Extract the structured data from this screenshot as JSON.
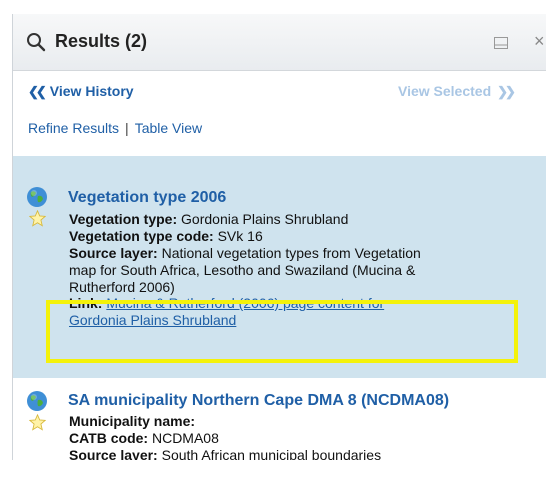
{
  "header": {
    "title": "Results (2)"
  },
  "nav": {
    "view_history": "View History",
    "view_selected": "View Selected"
  },
  "links": {
    "refine": "Refine Results",
    "separator": "|",
    "table_view": "Table View"
  },
  "results": [
    {
      "title": "Vegetation type 2006",
      "fields": [
        {
          "label": "Vegetation type:",
          "value": "Gordonia Plains Shrubland"
        },
        {
          "label": "Vegetation type code:",
          "value": "SVk 16"
        }
      ],
      "source_label": "Source layer:",
      "source_lines": [
        "National vegetation types from Vegetation",
        "map for South Africa, Lesotho and Swaziland (Mucina &",
        "Rutherford 2006)"
      ],
      "link_label": "Link:",
      "link_lines": [
        "Mucina & Rutherford (2006) page content for",
        "Gordonia Plains Shrubland"
      ],
      "selected": true,
      "highlighted": true
    },
    {
      "title": "SA municipality Northern Cape DMA 8 (NCDMA08)",
      "fields": [
        {
          "label": "Municipality name:",
          "value": ""
        },
        {
          "label": "CATB code:",
          "value": "NCDMA08"
        }
      ],
      "source_label": "Source layer:",
      "source_lines": [
        "South African municipal boundaries"
      ],
      "selected": false,
      "highlighted": false
    }
  ],
  "colors": {
    "link": "#1f5fa6",
    "selected_row": "#cfe3ee",
    "highlight_box": "#f4f20a",
    "disabled_link": "#a9c6e4"
  },
  "icons": [
    "search-icon",
    "minimize-icon",
    "close-icon",
    "globe-icon",
    "star-icon"
  ]
}
